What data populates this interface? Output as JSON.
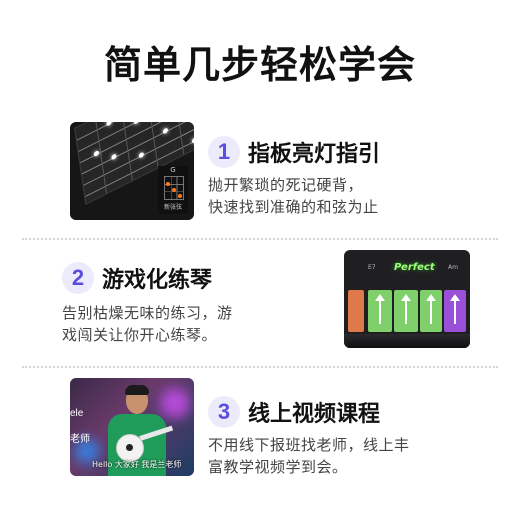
{
  "page": {
    "title": "简单几步轻松学会"
  },
  "steps": [
    {
      "number": "1",
      "title": "指板亮灯指引",
      "desc_line1": "抛开繁琐的死记硬背，",
      "desc_line2": "快速找到准确的和弦为止"
    },
    {
      "number": "2",
      "title": "游戏化练琴",
      "desc_line1": "告别枯燥无味的练习，游",
      "desc_line2": "戏闯关让你开心练琴。"
    },
    {
      "number": "3",
      "title": "线上视频课程",
      "desc_line1": "不用线下报班找老师，线上丰",
      "desc_line2": "富教学视频学到会。"
    }
  ],
  "thumbnails": {
    "fretboard": {
      "chord_name": "G",
      "caption": "新张弦"
    },
    "game": {
      "feedback": "Perfect",
      "lane_left": "E7",
      "lane_right": "Am"
    },
    "video": {
      "side_text_top": "ele",
      "side_text_bottom": "老师",
      "caption": "Hello 大家好 我是兰老师"
    }
  },
  "colors": {
    "accent": "#5a4fdc",
    "badge_bg": "#ecebfb",
    "divider": "#d8d8d8"
  }
}
